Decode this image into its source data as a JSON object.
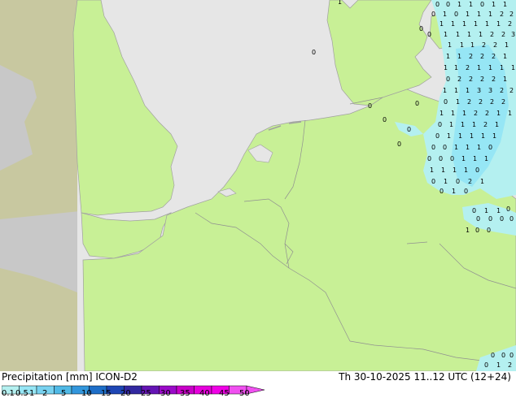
{
  "title_left": "Precipitation [mm]  ICON-D2",
  "title_right": "Th 30-10-2025 11..12 UTC (12+24)",
  "legend": {
    "ticks": [
      "0.1",
      "0.5",
      "1",
      "2",
      "5",
      "10",
      "15",
      "20",
      "25",
      "30",
      "35",
      "40",
      "45",
      "50"
    ],
    "colors": [
      "#b4f0f0",
      "#96e6f5",
      "#78d2f0",
      "#50b9e6",
      "#3296dc",
      "#1e6ec8",
      "#1e46b4",
      "#3228a0",
      "#6414b4",
      "#9a0ac8",
      "#c800c8",
      "#e600dc",
      "#f000e6",
      "#f050f0"
    ]
  },
  "map_colors": {
    "land_in_domain": "#c8f096",
    "sea": "#e6e6e6",
    "outside_land": "#c8c8a0",
    "outside_sea": "#c8c8c8",
    "rain_light": "#b4f0f0",
    "rain_moderate": "#96e6f5",
    "border": "#a0a0a0"
  },
  "precip_values": [
    "0",
    "1",
    "2",
    "3"
  ]
}
